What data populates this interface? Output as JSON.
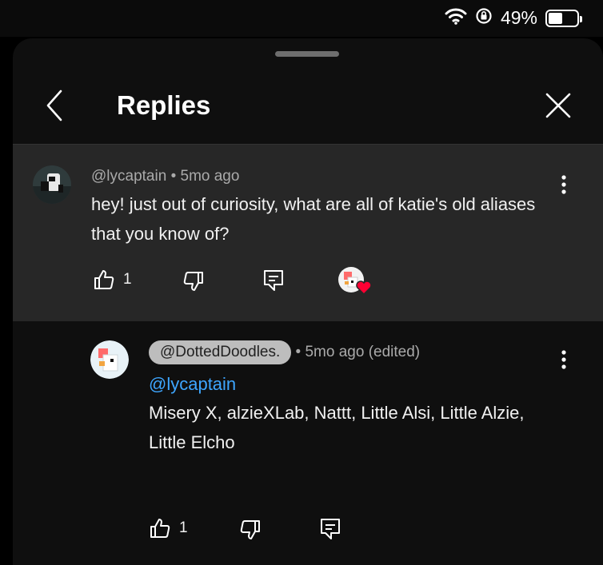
{
  "status_bar": {
    "battery_percent": "49%",
    "battery_level": 0.49
  },
  "header": {
    "title": "Replies"
  },
  "parent": {
    "author": "@lycaptain",
    "time": "5mo ago",
    "text": "hey! just out of curiosity, what are all of katie's old aliases that you know of?",
    "like_count": "1"
  },
  "reply": {
    "author": "@DottedDoodles.",
    "time": "5mo ago (edited)",
    "mention": "@lycaptain",
    "text": "Misery X, alzieXLab, Nattt, Little Alsi, Little Alzie, Little Elcho",
    "like_count": "1"
  },
  "icons": [
    "wifi-icon",
    "rotation-lock-icon",
    "battery-icon",
    "back-icon",
    "close-icon",
    "more-icon",
    "like-icon",
    "dislike-icon",
    "reply-icon",
    "creator-heart-icon"
  ],
  "colors": {
    "background": "#0f0f0f",
    "highlight": "#272727",
    "link": "#3ea6ff",
    "heart": "#ff0033"
  }
}
